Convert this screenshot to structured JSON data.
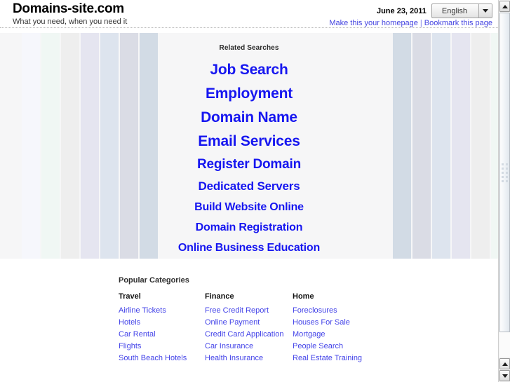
{
  "header": {
    "site_title": "Domains-site.com",
    "tagline": "What you need, when you need it",
    "date": "June 23, 2011",
    "language": "English",
    "language_icon": "chevron-down-icon",
    "homepage_link": "Make this your homepage",
    "separator": "|",
    "bookmark_link": "Bookmark this page"
  },
  "related": {
    "heading": "Related Searches",
    "links": [
      {
        "label": "Job Search",
        "size": 21
      },
      {
        "label": "Employment",
        "size": 21
      },
      {
        "label": "Domain Name",
        "size": 21
      },
      {
        "label": "Email Services",
        "size": 21
      },
      {
        "label": "Register Domain",
        "size": 19
      },
      {
        "label": "Dedicated Servers",
        "size": 17
      },
      {
        "label": "Build Website Online",
        "size": 16
      },
      {
        "label": "Domain Registration",
        "size": 16
      },
      {
        "label": "Online Business Education",
        "size": 16
      }
    ],
    "stripe_colors": [
      "#f6f7fc",
      "#f0f7f4",
      "#eeeeee",
      "#e5e5f0",
      "#dde4ee",
      "#dadce5",
      "#d2dbe5"
    ],
    "stripe_width": 26
  },
  "popular": {
    "heading": "Popular Categories",
    "columns": [
      {
        "title": "Travel",
        "links": [
          "Airline Tickets",
          "Hotels",
          "Car Rental",
          "Flights",
          "South Beach Hotels"
        ]
      },
      {
        "title": "Finance",
        "links": [
          "Free Credit Report",
          "Online Payment",
          "Credit Card Application",
          "Car Insurance",
          "Health Insurance"
        ]
      },
      {
        "title": "Home",
        "links": [
          "Foreclosures",
          "Houses For Sale",
          "Mortgage",
          "People Search",
          "Real Estate Training"
        ]
      }
    ]
  },
  "scrollbar": {
    "up_icon": "triangle-up-icon",
    "down_icon": "triangle-down-icon",
    "grip_icon": "grip-dots-icon"
  },
  "colors": {
    "link_blue": "#4343e8",
    "related_blue": "#1616f0",
    "panel_bg": "#f6f6f7"
  }
}
